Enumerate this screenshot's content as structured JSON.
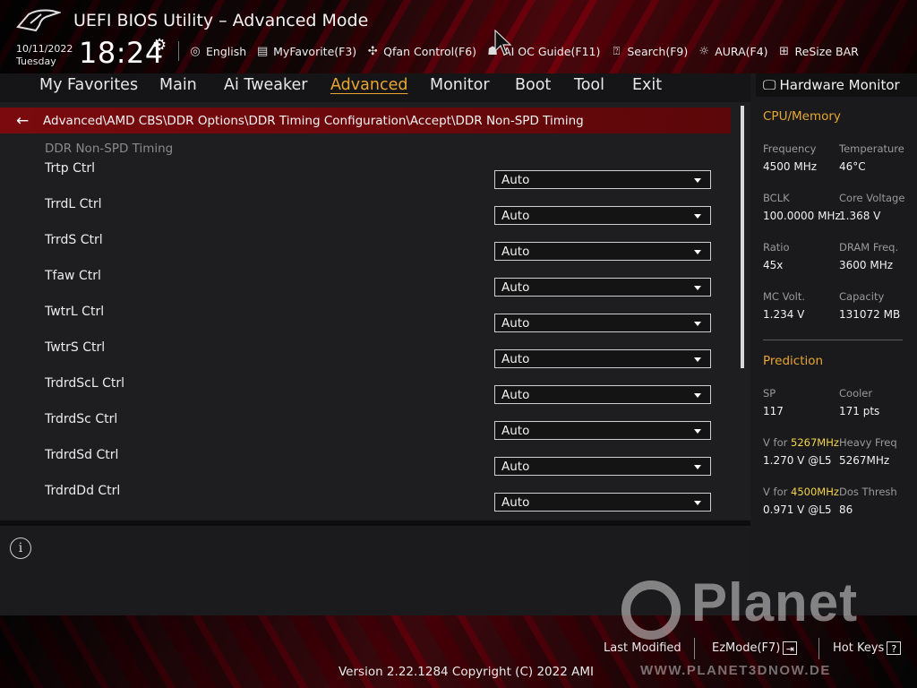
{
  "header": {
    "title": "UEFI BIOS Utility – Advanced Mode",
    "date": "10/11/2022",
    "day": "Tuesday",
    "time": "18:24",
    "toolbar": [
      {
        "icon": "globe-icon",
        "label": "English"
      },
      {
        "icon": "favorite-icon",
        "label": "MyFavorite(F3)"
      },
      {
        "icon": "fan-icon",
        "label": "Qfan Control(F6)"
      },
      {
        "icon": "oc-guide-icon",
        "label": "AI OC Guide(F11)"
      },
      {
        "icon": "search-icon",
        "label": "Search(F9)"
      },
      {
        "icon": "aura-icon",
        "label": "AURA(F4)"
      },
      {
        "icon": "resize-bar-icon",
        "label": "ReSize BAR"
      }
    ]
  },
  "menu": [
    "My Favorites",
    "Main",
    "Ai Tweaker",
    "Advanced",
    "Monitor",
    "Boot",
    "Tool",
    "Exit"
  ],
  "menu_active": "Advanced",
  "breadcrumb": "Advanced\\AMD CBS\\DDR Options\\DDR Timing Configuration\\Accept\\DDR Non-SPD Timing",
  "section_title": "DDR Non-SPD Timing",
  "settings": [
    {
      "label": "Trtp Ctrl",
      "value": "Auto"
    },
    {
      "label": "TrrdL Ctrl",
      "value": "Auto"
    },
    {
      "label": "TrrdS Ctrl",
      "value": "Auto"
    },
    {
      "label": "Tfaw Ctrl",
      "value": "Auto"
    },
    {
      "label": "TwtrL Ctrl",
      "value": "Auto"
    },
    {
      "label": "TwtrS Ctrl",
      "value": "Auto"
    },
    {
      "label": "TrdrdScL Ctrl",
      "value": "Auto"
    },
    {
      "label": "TrdrdSc Ctrl",
      "value": "Auto"
    },
    {
      "label": "TrdrdSd Ctrl",
      "value": "Auto"
    },
    {
      "label": "TrdrdDd Ctrl",
      "value": "Auto"
    }
  ],
  "hw": {
    "title": "Hardware Monitor",
    "cpu_section": "CPU/Memory",
    "frequency_label": "Frequency",
    "frequency": "4500 MHz",
    "temperature_label": "Temperature",
    "temperature": "46°C",
    "bclk_label": "BCLK",
    "bclk": "100.0000 MHz",
    "core_voltage_label": "Core Voltage",
    "core_voltage": "1.368 V",
    "ratio_label": "Ratio",
    "ratio": "45x",
    "dram_freq_label": "DRAM Freq.",
    "dram_freq": "3600 MHz",
    "mc_volt_label": "MC Volt.",
    "mc_volt": "1.234 V",
    "capacity_label": "Capacity",
    "capacity": "131072 MB",
    "prediction_section": "Prediction",
    "sp_label": "SP",
    "sp": "117",
    "cooler_label": "Cooler",
    "cooler": "171 pts",
    "v_for_label": "V for ",
    "v1_freq": "5267MHz",
    "v1_value": "1.270 V @L5",
    "heavy_freq_label": "Heavy Freq",
    "heavy_freq": "5267MHz",
    "v2_freq": "4500MHz",
    "v2_value": "0.971 V @L5",
    "dos_thresh_label": "Dos Thresh",
    "dos_thresh": "86"
  },
  "footer": {
    "last_modified": "Last Modified",
    "ezmode": "EzMode(F7)",
    "hot_keys": "Hot Keys",
    "hot_keys_box": "?",
    "version": "Version 2.22.1284 Copyright (C) 2022 AMI"
  },
  "watermark": {
    "text": "Planet",
    "url": "WWW.PLANET3DNOW.DE"
  },
  "colors": {
    "accent": "#e8a630",
    "breadcrumb_bg": "#7a0a0e",
    "highlight": "#f4d44a"
  }
}
